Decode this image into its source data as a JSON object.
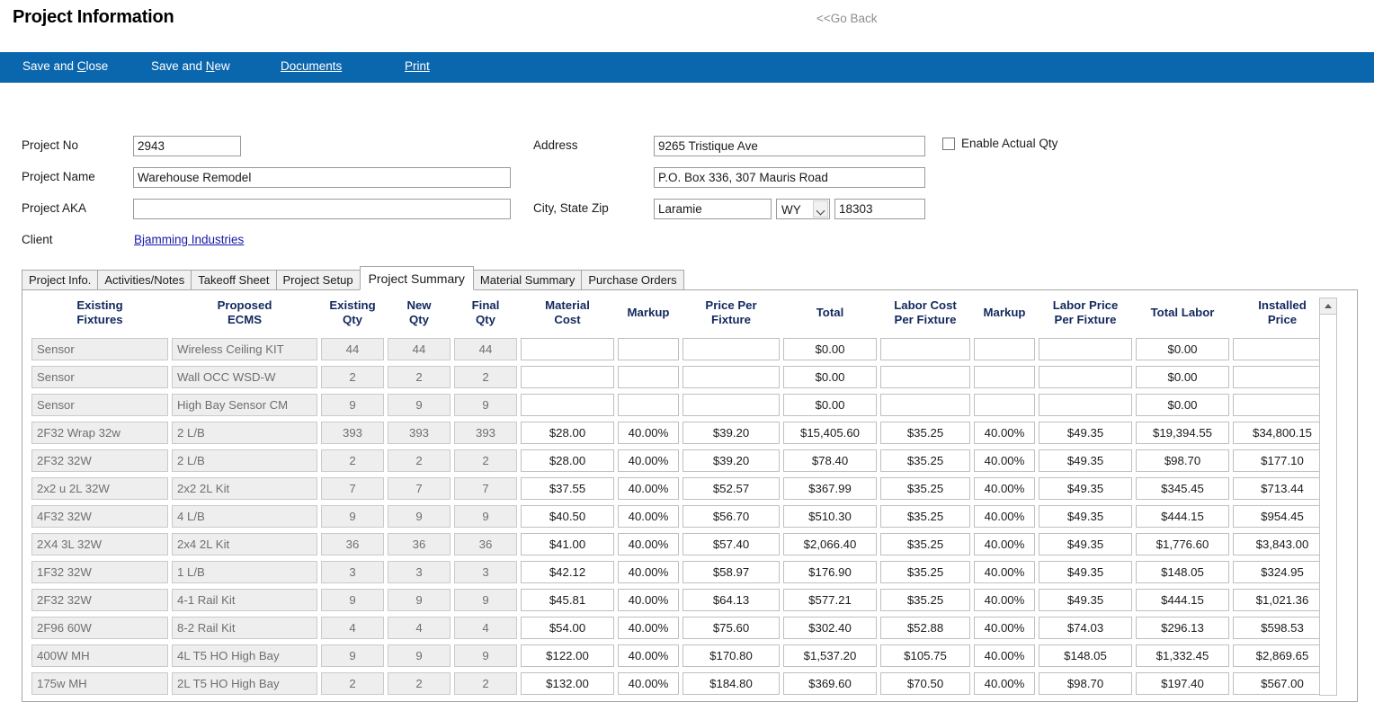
{
  "header": {
    "title": "Project Information",
    "go_back": "<<Go Back"
  },
  "toolbar": {
    "items": [
      {
        "label": "Save and Close",
        "accel": "C"
      },
      {
        "label": "Save and New",
        "accel": "N"
      },
      {
        "label": "Documents",
        "accel": "D"
      },
      {
        "label": "Print",
        "accel": "P"
      }
    ]
  },
  "form": {
    "project_no_label": "Project No",
    "project_no_value": "2943",
    "project_name_label": "Project Name",
    "project_name_value": "Warehouse Remodel",
    "project_aka_label": "Project AKA",
    "project_aka_value": "",
    "client_label": "Client",
    "client_value": "Bjamming Industries",
    "address_label": "Address",
    "address_line1": "9265 Tristique Ave",
    "address_line2": "P.O. Box 336, 307 Mauris Road",
    "city_state_zip_label": "City, State Zip",
    "city_value": "Laramie",
    "state_value": "WY",
    "zip_value": "18303",
    "enable_actual_qty_label": "Enable Actual Qty",
    "enable_actual_qty_checked": false
  },
  "tabs": {
    "active": "Project Summary",
    "items": [
      "Project Info.",
      "Activities/Notes",
      "Takeoff Sheet",
      "Project Setup",
      "Project Summary",
      "Material Summary",
      "Purchase Orders"
    ]
  },
  "grid": {
    "columns": [
      "Existing Fixtures",
      "Proposed ECMS",
      "Existing Qty",
      "New Qty",
      "Final Qty",
      "Material Cost",
      "Markup",
      "Price Per Fixture",
      "Total",
      "Labor Cost Per Fixture",
      "Markup",
      "Labor Price Per Fixture",
      "Total Labor",
      "Installed Price"
    ],
    "column_lines": [
      [
        "Existing",
        "Fixtures"
      ],
      [
        "Proposed",
        "ECMS"
      ],
      [
        "Existing",
        "Qty"
      ],
      [
        "New",
        "Qty"
      ],
      [
        "Final",
        "Qty"
      ],
      [
        "Material",
        "Cost"
      ],
      [
        "Markup",
        ""
      ],
      [
        "Price Per",
        "Fixture"
      ],
      [
        "Total",
        ""
      ],
      [
        "Labor Cost",
        "Per Fixture"
      ],
      [
        "Markup",
        ""
      ],
      [
        "Labor Price",
        "Per Fixture"
      ],
      [
        "Total Labor",
        ""
      ],
      [
        "Installed",
        "Price"
      ]
    ],
    "rows": [
      {
        "existing_fixtures": "Sensor",
        "proposed_ecms": "Wireless Ceiling KIT",
        "existing_qty": "44",
        "new_qty": "44",
        "final_qty": "44",
        "material_cost": "",
        "markup": "",
        "price_per_fixture": "",
        "total": "$0.00",
        "labor_cost_per_fixture": "",
        "labor_markup": "",
        "labor_price_per_fixture": "",
        "total_labor": "$0.00",
        "installed_price": ""
      },
      {
        "existing_fixtures": "Sensor",
        "proposed_ecms": "Wall OCC WSD-W",
        "existing_qty": "2",
        "new_qty": "2",
        "final_qty": "2",
        "material_cost": "",
        "markup": "",
        "price_per_fixture": "",
        "total": "$0.00",
        "labor_cost_per_fixture": "",
        "labor_markup": "",
        "labor_price_per_fixture": "",
        "total_labor": "$0.00",
        "installed_price": ""
      },
      {
        "existing_fixtures": "Sensor",
        "proposed_ecms": "High Bay Sensor CM",
        "existing_qty": "9",
        "new_qty": "9",
        "final_qty": "9",
        "material_cost": "",
        "markup": "",
        "price_per_fixture": "",
        "total": "$0.00",
        "labor_cost_per_fixture": "",
        "labor_markup": "",
        "labor_price_per_fixture": "",
        "total_labor": "$0.00",
        "installed_price": ""
      },
      {
        "existing_fixtures": "2F32 Wrap 32w",
        "proposed_ecms": "2 L/B",
        "existing_qty": "393",
        "new_qty": "393",
        "final_qty": "393",
        "material_cost": "$28.00",
        "markup": "40.00%",
        "price_per_fixture": "$39.20",
        "total": "$15,405.60",
        "labor_cost_per_fixture": "$35.25",
        "labor_markup": "40.00%",
        "labor_price_per_fixture": "$49.35",
        "total_labor": "$19,394.55",
        "installed_price": "$34,800.15"
      },
      {
        "existing_fixtures": "2F32 32W",
        "proposed_ecms": "2 L/B",
        "existing_qty": "2",
        "new_qty": "2",
        "final_qty": "2",
        "material_cost": "$28.00",
        "markup": "40.00%",
        "price_per_fixture": "$39.20",
        "total": "$78.40",
        "labor_cost_per_fixture": "$35.25",
        "labor_markup": "40.00%",
        "labor_price_per_fixture": "$49.35",
        "total_labor": "$98.70",
        "installed_price": "$177.10"
      },
      {
        "existing_fixtures": "2x2 u 2L 32W",
        "proposed_ecms": "2x2 2L Kit",
        "existing_qty": "7",
        "new_qty": "7",
        "final_qty": "7",
        "material_cost": "$37.55",
        "markup": "40.00%",
        "price_per_fixture": "$52.57",
        "total": "$367.99",
        "labor_cost_per_fixture": "$35.25",
        "labor_markup": "40.00%",
        "labor_price_per_fixture": "$49.35",
        "total_labor": "$345.45",
        "installed_price": "$713.44"
      },
      {
        "existing_fixtures": "4F32 32W",
        "proposed_ecms": "4 L/B",
        "existing_qty": "9",
        "new_qty": "9",
        "final_qty": "9",
        "material_cost": "$40.50",
        "markup": "40.00%",
        "price_per_fixture": "$56.70",
        "total": "$510.30",
        "labor_cost_per_fixture": "$35.25",
        "labor_markup": "40.00%",
        "labor_price_per_fixture": "$49.35",
        "total_labor": "$444.15",
        "installed_price": "$954.45"
      },
      {
        "existing_fixtures": "2X4 3L 32W",
        "proposed_ecms": "2x4 2L Kit",
        "existing_qty": "36",
        "new_qty": "36",
        "final_qty": "36",
        "material_cost": "$41.00",
        "markup": "40.00%",
        "price_per_fixture": "$57.40",
        "total": "$2,066.40",
        "labor_cost_per_fixture": "$35.25",
        "labor_markup": "40.00%",
        "labor_price_per_fixture": "$49.35",
        "total_labor": "$1,776.60",
        "installed_price": "$3,843.00"
      },
      {
        "existing_fixtures": "1F32 32W",
        "proposed_ecms": "1 L/B",
        "existing_qty": "3",
        "new_qty": "3",
        "final_qty": "3",
        "material_cost": "$42.12",
        "markup": "40.00%",
        "price_per_fixture": "$58.97",
        "total": "$176.90",
        "labor_cost_per_fixture": "$35.25",
        "labor_markup": "40.00%",
        "labor_price_per_fixture": "$49.35",
        "total_labor": "$148.05",
        "installed_price": "$324.95"
      },
      {
        "existing_fixtures": "2F32 32W",
        "proposed_ecms": "4-1 Rail Kit",
        "existing_qty": "9",
        "new_qty": "9",
        "final_qty": "9",
        "material_cost": "$45.81",
        "markup": "40.00%",
        "price_per_fixture": "$64.13",
        "total": "$577.21",
        "labor_cost_per_fixture": "$35.25",
        "labor_markup": "40.00%",
        "labor_price_per_fixture": "$49.35",
        "total_labor": "$444.15",
        "installed_price": "$1,021.36"
      },
      {
        "existing_fixtures": "2F96 60W",
        "proposed_ecms": "8-2 Rail Kit",
        "existing_qty": "4",
        "new_qty": "4",
        "final_qty": "4",
        "material_cost": "$54.00",
        "markup": "40.00%",
        "price_per_fixture": "$75.60",
        "total": "$302.40",
        "labor_cost_per_fixture": "$52.88",
        "labor_markup": "40.00%",
        "labor_price_per_fixture": "$74.03",
        "total_labor": "$296.13",
        "installed_price": "$598.53"
      },
      {
        "existing_fixtures": "400W MH",
        "proposed_ecms": "4L T5 HO High Bay",
        "existing_qty": "9",
        "new_qty": "9",
        "final_qty": "9",
        "material_cost": "$122.00",
        "markup": "40.00%",
        "price_per_fixture": "$170.80",
        "total": "$1,537.20",
        "labor_cost_per_fixture": "$105.75",
        "labor_markup": "40.00%",
        "labor_price_per_fixture": "$148.05",
        "total_labor": "$1,332.45",
        "installed_price": "$2,869.65"
      },
      {
        "existing_fixtures": "175w MH",
        "proposed_ecms": "2L T5 HO High Bay",
        "existing_qty": "2",
        "new_qty": "2",
        "final_qty": "2",
        "material_cost": "$132.00",
        "markup": "40.00%",
        "price_per_fixture": "$184.80",
        "total": "$369.60",
        "labor_cost_per_fixture": "$70.50",
        "labor_markup": "40.00%",
        "labor_price_per_fixture": "$98.70",
        "total_labor": "$197.40",
        "installed_price": "$567.00"
      }
    ]
  },
  "colors": {
    "toolbar_bg": "#0a66ad",
    "header_text": "#12295e",
    "link": "#1818a8",
    "readonly_bg": "#eeeeee"
  }
}
